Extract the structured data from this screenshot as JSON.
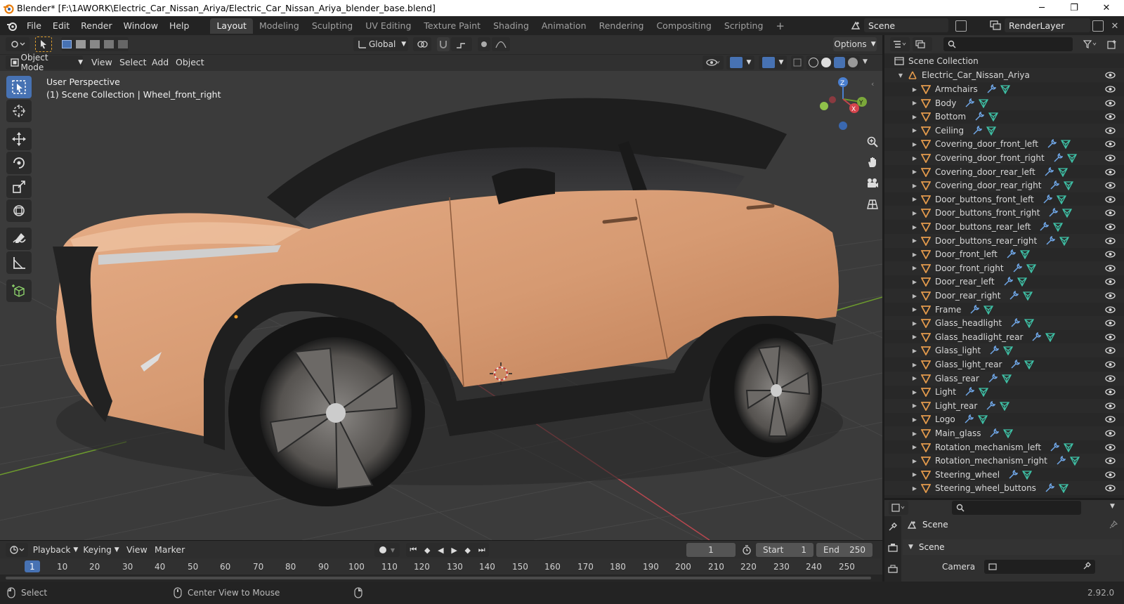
{
  "window": {
    "title": "Blender* [F:\\1AWORK\\Electric_Car_Nissan_Ariya/Electric_Car_Nissan_Ariya_blender_base.blend]",
    "minimize": "─",
    "maximize": "❐",
    "close": "✕"
  },
  "menubar": {
    "items": [
      "File",
      "Edit",
      "Render",
      "Window",
      "Help"
    ],
    "workspaces": [
      "Layout",
      "Modeling",
      "Sculpting",
      "UV Editing",
      "Texture Paint",
      "Shading",
      "Animation",
      "Rendering",
      "Compositing",
      "Scripting"
    ],
    "active_workspace": "Layout",
    "add_tab": "+",
    "scene": "Scene",
    "view_layer": "RenderLayer"
  },
  "viewport_header": {
    "transform_orientation": "Global",
    "options": "Options",
    "mode": "Object Mode",
    "menus": [
      "View",
      "Select",
      "Add",
      "Object"
    ]
  },
  "viewport": {
    "perspective": "User Perspective",
    "context": "(1) Scene Collection | Wheel_front_right",
    "gizmo_z": "Z",
    "gizmo_y": "Y",
    "gizmo_x": "X"
  },
  "timeline": {
    "menus": [
      "Playback",
      "Keying",
      "View",
      "Marker"
    ],
    "current_frame": "1",
    "start_label": "Start",
    "start": "1",
    "end_label": "End",
    "end": "250",
    "ruler": [
      "1",
      "10",
      "20",
      "30",
      "40",
      "50",
      "60",
      "70",
      "80",
      "90",
      "100",
      "110",
      "120",
      "130",
      "140",
      "150",
      "160",
      "170",
      "180",
      "190",
      "200",
      "210",
      "220",
      "230",
      "240",
      "250"
    ]
  },
  "statusbar": {
    "left": "Select",
    "middle": "Center View to Mouse",
    "version": "2.92.0"
  },
  "outliner": {
    "root": "Scene Collection",
    "collection": "Electric_Car_Nissan_Ariya",
    "items": [
      "Armchairs",
      "Body",
      "Bottom",
      "Ceiling",
      "Covering_door_front_left",
      "Covering_door_front_right",
      "Covering_door_rear_left",
      "Covering_door_rear_right",
      "Door_buttons_front_left",
      "Door_buttons_front_right",
      "Door_buttons_rear_left",
      "Door_buttons_rear_right",
      "Door_front_left",
      "Door_front_right",
      "Door_rear_left",
      "Door_rear_right",
      "Frame",
      "Glass_headlight",
      "Glass_headlight_rear",
      "Glass_light",
      "Glass_light_rear",
      "Glass_rear",
      "Light",
      "Light_rear",
      "Logo",
      "Main_glass",
      "Rotation_mechanism_left",
      "Rotation_mechanism_right",
      "Steering_wheel",
      "Steering_wheel_buttons"
    ]
  },
  "properties": {
    "header": "Scene",
    "panel": "Scene",
    "camera_label": "Camera"
  },
  "colors": {
    "accent": "#4772b3",
    "car_body": "#d99870",
    "mesh_icon": "#e39a4c",
    "modifier_icon": "#6fa6e6",
    "data_icon": "#3fc3a8",
    "grid": "#474747",
    "x_axis": "#b8474f",
    "y_axis": "#6c9a2d"
  }
}
